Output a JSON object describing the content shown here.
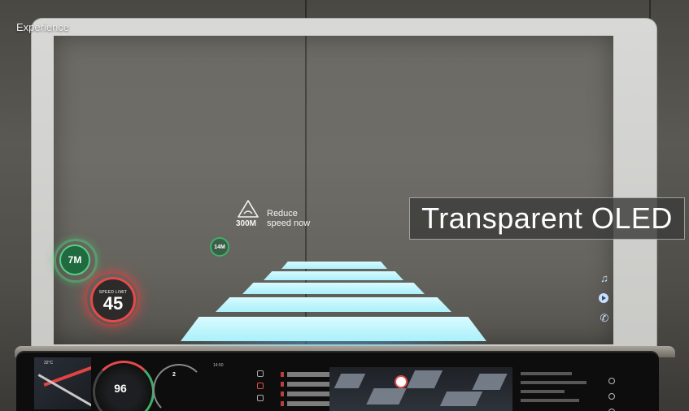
{
  "video": {
    "channel_label": "Experience",
    "caption": "Transparent OLED"
  },
  "hud": {
    "warning": {
      "icon": "warning-triangle-icon",
      "distance": "300M",
      "line1": "Reduce",
      "line2": "speed now"
    },
    "distance_marker": "14M",
    "next_distance": "7M",
    "speed_limit": {
      "label": "SPEED LIMIT",
      "value": "45"
    },
    "side_icons": [
      "music-note-icon",
      "play-icon",
      "phone-icon"
    ],
    "colors": {
      "lane": "#aaf0fb",
      "speed_limit_ring": "#e94848",
      "distance_ring": "#58d083"
    }
  },
  "dashboard": {
    "temperature": "32°C",
    "speed": "96",
    "nav_distance": "2",
    "clock": "14:50"
  }
}
